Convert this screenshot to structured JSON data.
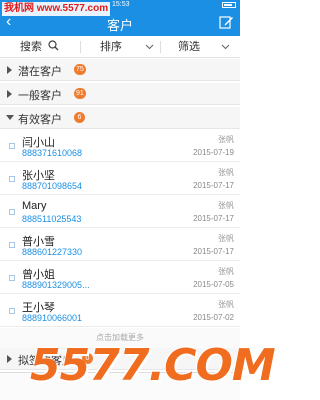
{
  "watermark_top": "我机网 www.5577.com",
  "status": {
    "time": "15:53"
  },
  "nav": {
    "title": "客户"
  },
  "filters": {
    "search_label": "搜索",
    "sort_label": "排序",
    "filter_label": "筛选"
  },
  "groups": [
    {
      "label": "潜在客户",
      "count": "75"
    },
    {
      "label": "一般客户",
      "count": "91"
    },
    {
      "label": "有效客户",
      "count": "6"
    }
  ],
  "customers": [
    {
      "name": "闫小山",
      "phone": "888371610068",
      "owner": "张帆",
      "date": "2015-07-19"
    },
    {
      "name": "张小坚",
      "phone": "888701098654",
      "owner": "张帆",
      "date": "2015-07-17"
    },
    {
      "name": "Mary",
      "phone": "888511025543",
      "owner": "张帆",
      "date": "2015-07-17"
    },
    {
      "name": "普小雪",
      "phone": "888601227330",
      "owner": "张帆",
      "date": "2015-07-17"
    },
    {
      "name": "曾小姐",
      "phone": "888901329005...",
      "owner": "张帆",
      "date": "2015-07-05"
    },
    {
      "name": "王小琴",
      "phone": "888910066001",
      "owner": "张帆",
      "date": "2015-07-02"
    }
  ],
  "load_more": "点击加载更多",
  "bottom_group": {
    "label": "拟签约客户",
    "count": "0"
  },
  "watermark_big": "5577.COM",
  "colors": {
    "primary": "#1a8fe3",
    "badge": "#f07b2e",
    "watermark": "#f06d1f"
  }
}
